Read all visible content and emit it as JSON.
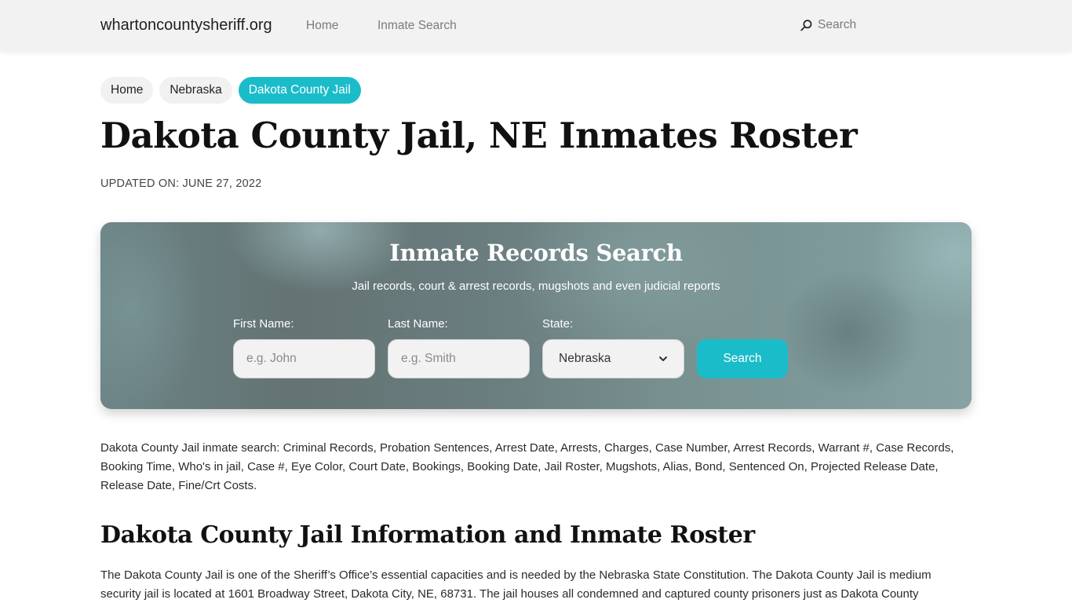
{
  "header": {
    "brand": "whartoncountysheriff.org",
    "nav": [
      {
        "label": "Home"
      },
      {
        "label": "Inmate Search"
      }
    ],
    "search_label": "Search",
    "search_icon": "magnifier-icon"
  },
  "breadcrumb": [
    {
      "label": "Home",
      "active": false
    },
    {
      "label": "Nebraska",
      "active": false
    },
    {
      "label": "Dakota County Jail",
      "active": true
    }
  ],
  "page": {
    "title": "Dakota County Jail, NE Inmates Roster",
    "updated": "UPDATED ON: JUNE 27, 2022"
  },
  "search_card": {
    "title": "Inmate Records Search",
    "subtitle": "Jail records, court & arrest records, mugshots and even judicial reports",
    "first_name": {
      "label": "First Name:",
      "placeholder": "e.g. John",
      "value": ""
    },
    "last_name": {
      "label": "Last Name:",
      "placeholder": "e.g. Smith",
      "value": ""
    },
    "state": {
      "label": "State:",
      "selected": "Nebraska"
    },
    "button_label": "Search"
  },
  "content": {
    "keywords_paragraph": "Dakota County Jail inmate search: Criminal Records, Probation Sentences, Arrest Date, Arrests, Charges, Case Number, Arrest Records, Warrant #, Case Records, Booking Time, Who's in jail, Case #, Eye Color, Court Date, Bookings, Booking Date, Jail Roster, Mugshots, Alias, Bond, Sentenced On, Projected Release Date, Release Date, Fine/Crt Costs.",
    "section_title": "Dakota County Jail Information and Inmate Roster",
    "info_paragraph": "The Dakota County Jail is one of the Sheriff’s Office’s essential capacities and is needed by the Nebraska State Constitution. The Dakota County Jail is medium security jail is located at 1601 Broadway Street, Dakota City, NE, 68731. The jail houses all condemned and captured county prisoners just as Dakota County"
  },
  "colors": {
    "accent": "#1bbcc9",
    "topbar_bg": "#f2f2f2",
    "chip_bg": "#f1f1f1"
  }
}
